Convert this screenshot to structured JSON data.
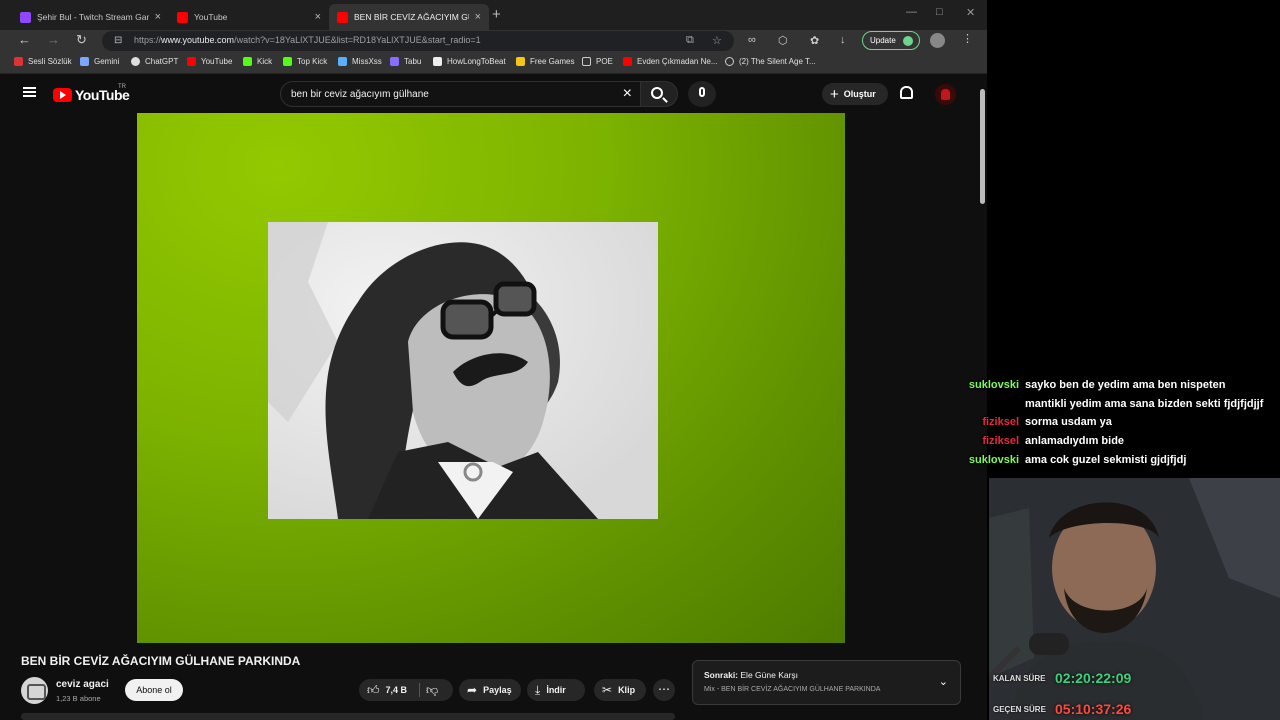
{
  "browser": {
    "tabs": [
      {
        "title": "Şehir Bul - Twitch Stream Games",
        "color": "#9146ff"
      },
      {
        "title": "YouTube",
        "color": "#ff0000"
      },
      {
        "title": "BEN BİR CEVİZ AĞACIYIM GÜLHANE",
        "color": "#ff0000"
      }
    ],
    "url_prefix": "https://",
    "url_host": "www.youtube.com",
    "url_path": "/watch?v=18YaLlXTJUE&list=RD18YaLlXTJUE&start_radio=1",
    "update_label": "Update",
    "bookmarks": [
      {
        "label": "Sesli Sözlük",
        "color": "#d33"
      },
      {
        "label": "Gemini",
        "color": "#7aa7ff"
      },
      {
        "label": "ChatGPT",
        "color": "#ddd"
      },
      {
        "label": "YouTube",
        "color": "#ff0000"
      },
      {
        "label": "Kick",
        "color": "#53fc18"
      },
      {
        "label": "Top Kick",
        "color": "#53fc18"
      },
      {
        "label": "MissXss",
        "color": "#5ab0ff"
      },
      {
        "label": "Tabu",
        "color": "#8a6cff"
      },
      {
        "label": "HowLongToBeat",
        "color": "#eee"
      },
      {
        "label": "Free Games",
        "color": "#f5c518"
      },
      {
        "label": "POE",
        "color": "#999"
      },
      {
        "label": "Evden Çıkmadan Ne...",
        "color": "#ff0000"
      },
      {
        "label": "(2) The Silent Age T...",
        "color": "#ccc"
      }
    ]
  },
  "youtube": {
    "logo_text": "YouTube",
    "logo_region": "TR",
    "search_query": "ben bir ceviz ağacıyım gülhane",
    "create_label": "Oluştur",
    "video_title": "BEN BİR CEVİZ AĞACIYIM GÜLHANE PARKINDA",
    "channel_name": "ceviz agaci",
    "channel_subs": "1,23 B abone",
    "subscribe_label": "Abone ol",
    "like_count": "7,4 B",
    "share_label": "Paylaş",
    "download_label": "İndir",
    "clip_label": "Klip",
    "next_prefix": "Sonraki:",
    "next_title": "Ele Güne Karşı",
    "next_sub": "Mix - BEN BİR CEVİZ AĞACIYIM GÜLHANE PARKINDA"
  },
  "chat": [
    {
      "user": "suklovski",
      "color": "#7cfc5a",
      "text": "sayko ben de yedim ama ben nispeten"
    },
    {
      "user": "",
      "color": "#7cfc5a",
      "text": "mantikli yedim ama sana bizden sekti fjdjfjdjjf"
    },
    {
      "user": "fiziksel",
      "color": "#e8283c",
      "text": "sorma usdam ya"
    },
    {
      "user": "fiziksel",
      "color": "#e8283c",
      "text": "anlamadıydım bide"
    },
    {
      "user": "suklovski",
      "color": "#7cfc5a",
      "text": "ama cok guzel sekmisti gjdjfjdj"
    }
  ],
  "overlay": {
    "remaining_label": "KALAN SÜRE",
    "remaining_value": "02:20:22:09",
    "remaining_color": "#3dd17a",
    "elapsed_label": "GEÇEN SÜRE",
    "elapsed_value": "05:10:37:26",
    "elapsed_color": "#ff4a3d"
  }
}
